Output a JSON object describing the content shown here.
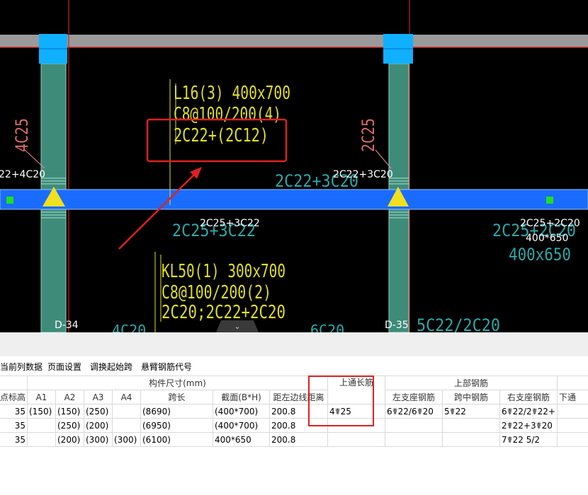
{
  "cad": {
    "beam_top": {
      "line1": "L16(3) 400x700",
      "line2": "C8@100/200(4)",
      "line3": "2C22+(2C12)"
    },
    "beam_bottom": {
      "line1": "KL50(1) 300x700",
      "line2": "C8@100/200(2)",
      "line3": "2C20;2C22+2C20"
    },
    "left_vertical": "4C25",
    "right_vertical": "2C25",
    "labels": {
      "left_support": "22+4C20",
      "mid_support": "2C22+3C20",
      "mid_support_shadow": "2C22+3C20",
      "below_left": "2C25+3C22",
      "below_left_shadow": "2C25+3C22",
      "right_span": "2C25+2C20",
      "right_span_shadow": "2C25+2C20",
      "right_section": "400*650",
      "right_section_shadow": "400x650",
      "axis_left": "D-34",
      "axis_right": "D-35",
      "bottom_right": "5C22/2C20",
      "bottom_mid": "4C20",
      "bottom_mid2": "6C20"
    }
  },
  "toolbar": {
    "items": [
      "当前列数据",
      "页面设置",
      "调换起始跨",
      "悬臂钢筋代号"
    ]
  },
  "table": {
    "group_headers": {
      "size": "构件尺寸(mm)",
      "top_through": "上通长筋",
      "top_rebar": "上部钢筋"
    },
    "columns": [
      "点标高",
      "A1",
      "A2",
      "A3",
      "A4",
      "跨长",
      "截面(B*H)",
      "距左边线距离",
      "",
      "左支座钢筋",
      "跨中钢筋",
      "右支座钢筋",
      "下通"
    ],
    "rows": [
      [
        "35",
        "(150)",
        "(150)",
        "(250)",
        "",
        "(8690)",
        "(400*700)",
        "200.8",
        "4☤25",
        "6☤22/6☤20",
        "5☤22",
        "6☤22/2☤22+"
      ],
      [
        "35",
        "",
        "(250)",
        "(200)",
        "",
        "(6950)",
        "(400*700)",
        "200.8",
        "",
        "",
        "",
        "2☤22+3☤20"
      ],
      [
        "35",
        "",
        "(200)",
        "(300)",
        "(300)",
        "(6100)",
        "400*650",
        "200.8",
        "",
        "",
        "",
        "7☤22 5/2"
      ]
    ]
  },
  "colors": {
    "beam_blue": "#1a6cff",
    "column_teal": "#3e8b7a",
    "cad_yellow": "#e0e020",
    "cad_cyan": "#2aa9a9",
    "accent_red": "#e02020"
  }
}
